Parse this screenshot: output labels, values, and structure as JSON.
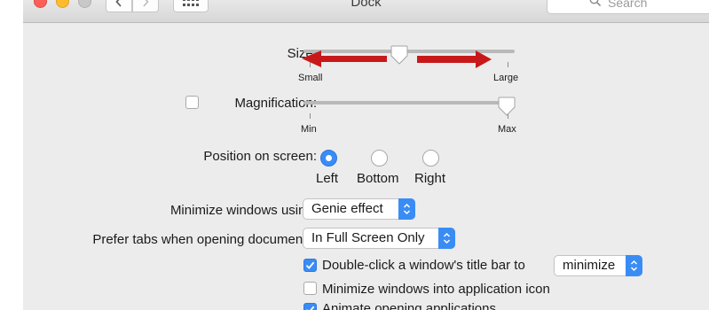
{
  "window": {
    "title": "Dock",
    "search_placeholder": "Search"
  },
  "size": {
    "label": "Size:",
    "min_label": "Small",
    "max_label": "Large",
    "value": 0.46
  },
  "magnification": {
    "label": "Magnification:",
    "checked": false,
    "min_label": "Min",
    "max_label": "Max",
    "value": 1.0
  },
  "position": {
    "label": "Position on screen:",
    "options": [
      "Left",
      "Bottom",
      "Right"
    ],
    "selected": "Left"
  },
  "minimize_using": {
    "label": "Minimize windows using:",
    "value": "Genie effect"
  },
  "prefer_tabs": {
    "label": "Prefer tabs when opening documents:",
    "value": "In Full Screen Only"
  },
  "double_click": {
    "label": "Double-click a window's title bar to",
    "checked": true,
    "action": "minimize"
  },
  "minimize_into_icon": {
    "label": "Minimize windows into application icon",
    "checked": false
  },
  "animate": {
    "label": "Animate opening applications",
    "checked": true
  },
  "colors": {
    "accent": "#3a8cf5",
    "annotation_arrow": "#c8191a"
  }
}
